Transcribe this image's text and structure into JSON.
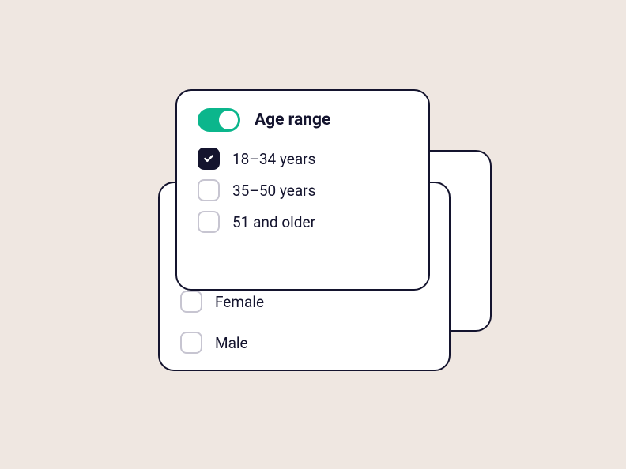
{
  "age_card": {
    "title": "Age range",
    "toggle_on": true,
    "options": [
      {
        "label": "18–34 years",
        "checked": true
      },
      {
        "label": "35–50 years",
        "checked": false
      },
      {
        "label": "51 and older",
        "checked": false
      }
    ]
  },
  "gender_card": {
    "options": [
      {
        "label": "Female",
        "checked": false
      },
      {
        "label": "Male",
        "checked": false
      }
    ]
  }
}
